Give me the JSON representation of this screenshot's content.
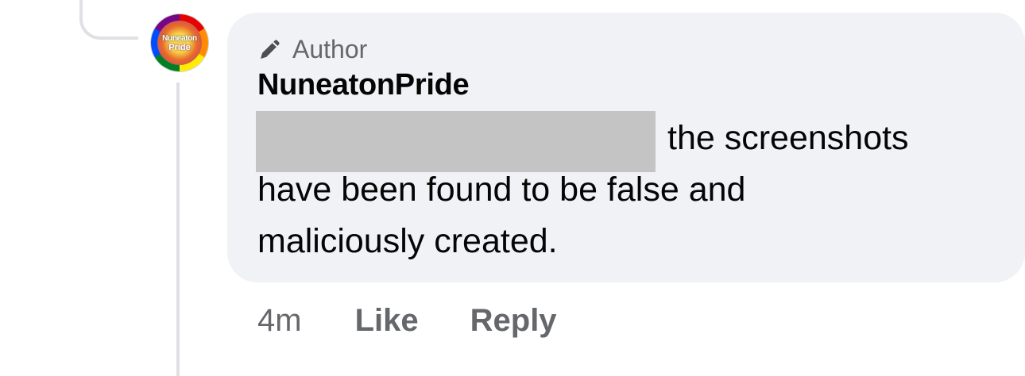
{
  "avatar": {
    "text_line1": "Nuneaton",
    "text_line2": "Pride"
  },
  "comment": {
    "author_badge": "Author",
    "author_badge_icon": "pencil-icon",
    "username": "NuneatonPride",
    "text_line1": "the screenshots",
    "text_line2": "have been found to be false and",
    "text_line3": "maliciously created.",
    "redacted": true
  },
  "actions": {
    "timestamp": "4m",
    "like_label": "Like",
    "reply_label": "Reply"
  },
  "colors": {
    "bubble_bg": "#f0f2f5",
    "secondary_text": "#65676b",
    "primary_text": "#050505",
    "redaction": "#c4c4c4"
  }
}
